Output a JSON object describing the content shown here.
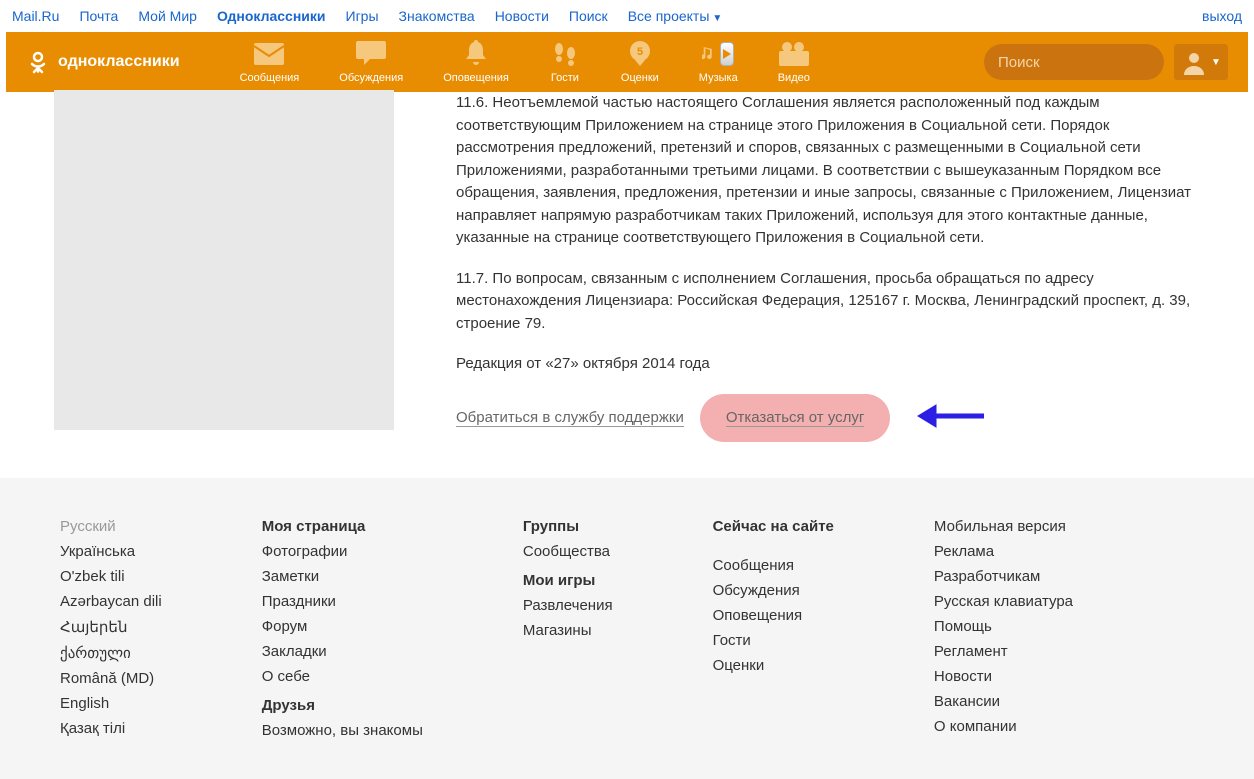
{
  "topbar": {
    "links": [
      "Mail.Ru",
      "Почта",
      "Мой Мир",
      "Одноклассники",
      "Игры",
      "Знакомства",
      "Новости",
      "Поиск",
      "Все проекты"
    ],
    "active_index": 3,
    "logout": "выход"
  },
  "header": {
    "logo_text": "одноклассники",
    "nav": [
      {
        "label": "Сообщения"
      },
      {
        "label": "Обсуждения"
      },
      {
        "label": "Оповещения"
      },
      {
        "label": "Гости"
      },
      {
        "label": "Оценки"
      },
      {
        "label": "Музыка"
      },
      {
        "label": "Видео"
      }
    ],
    "search_placeholder": "Поиск"
  },
  "content": {
    "p1": "11.6. Неотъемлемой частью настоящего Соглашения является расположенный под каждым соответствующим Приложением на странице этого Приложения в Социальной сети. Порядок рассмотрения предложений, претензий и споров, связанных с размещенными в Социальной сети Приложениями, разработанными третьими лицами. В соответствии с вышеуказанным Порядком все обращения, заявления, предложения, претензии и иные запросы, связанные с Приложением, Лицензиат направляет напрямую разработчикам таких Приложений, используя для этого контактные данные, указанные на странице соответствующего Приложения в Социальной сети.",
    "p2": "11.7. По вопросам, связанным с исполнением Соглашения, просьба обращаться по адресу местонахождения Лицензиара: Российская Федерация, 125167 г. Москва, Ленинградский проспект, д. 39, строение 79.",
    "p3": "Редакция от «27» октября 2014 года",
    "link_support": "Обратиться в службу поддержки",
    "link_refuse": "Отказаться от услуг"
  },
  "footer": {
    "col1": [
      "Русский",
      "Українська",
      "O'zbek tili",
      "Azərbaycan dili",
      "Հայերեն",
      "ქართული",
      "Română (MD)",
      "English",
      "Қазақ тілі"
    ],
    "col2": {
      "h1": "Моя страница",
      "items1": [
        "Фотографии",
        "Заметки",
        "Праздники",
        "Форум",
        "Закладки",
        "О себе"
      ],
      "h2": "Друзья",
      "items2": [
        "Возможно, вы знакомы"
      ]
    },
    "col3": {
      "h1": "Группы",
      "items1": [
        "Сообщества"
      ],
      "h2": "Мои игры",
      "items2": [
        "Развлечения",
        "Магазины"
      ]
    },
    "col4": {
      "h1": "Сейчас на сайте",
      "items1": [
        "Сообщения",
        "Обсуждения",
        "Оповещения",
        "Гости",
        "Оценки"
      ]
    },
    "col5": [
      "Мобильная версия",
      "Реклама",
      "Разработчикам",
      "Русская клавиатура",
      "Помощь",
      "Регламент",
      "Новости",
      "Вакансии",
      "О компании"
    ]
  }
}
